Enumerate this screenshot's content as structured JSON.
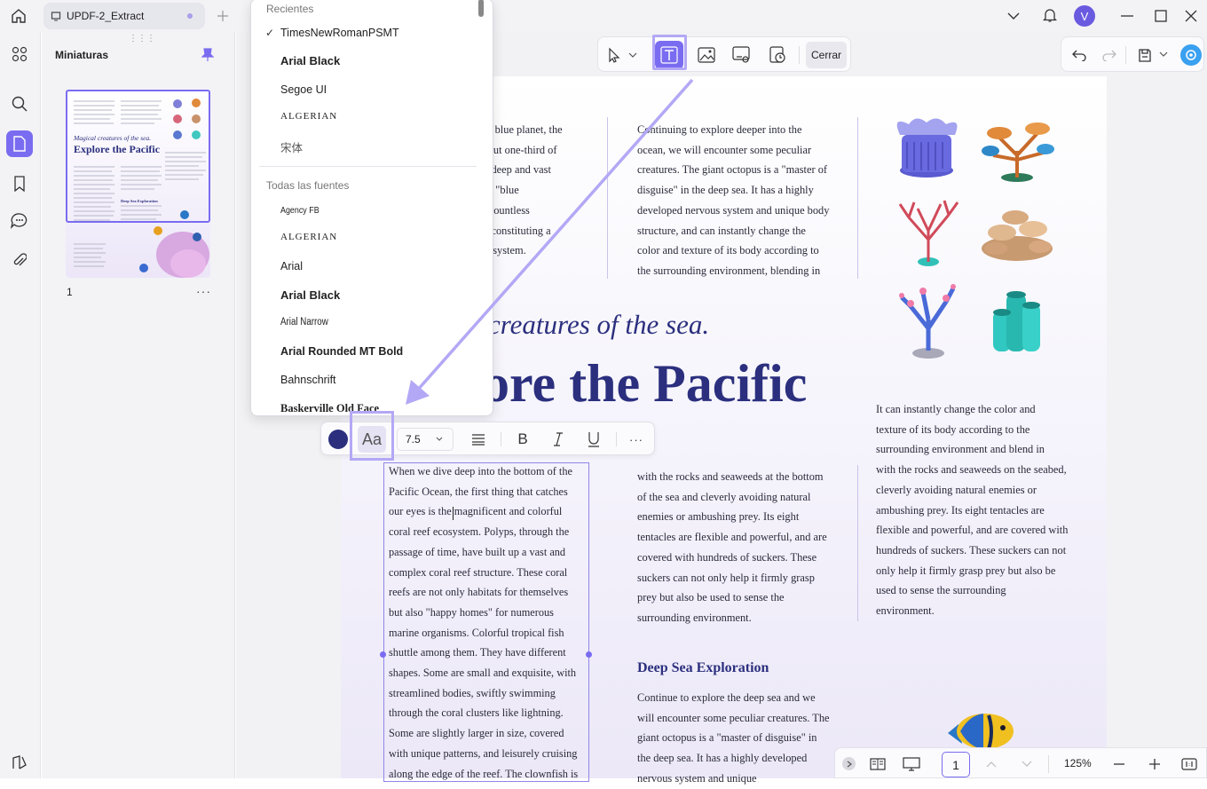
{
  "tab": {
    "title": "UPDF-2_Extract"
  },
  "user": {
    "initial": "V"
  },
  "panel": {
    "title": "Miniaturas",
    "page_number": "1",
    "more": "···"
  },
  "toolbar": {
    "close_label": "Cerrar"
  },
  "font_dropdown": {
    "recent_header": "Recientes",
    "recent": [
      "TimesNewRomanPSMT",
      "Arial Black",
      "Segoe UI",
      "ALGERIAN",
      "宋体"
    ],
    "selected": "TimesNewRomanPSMT",
    "check": "✓",
    "all_header": "Todas las fuentes",
    "all": [
      "Agency FB",
      "ALGERIAN",
      "Arial",
      "Arial Black",
      "Arial Narrow",
      "Arial Rounded MT Bold",
      "Bahnschrift",
      "Baskerville Old Face"
    ]
  },
  "format_bar": {
    "aa_label": "Aa",
    "font_size": "7.5",
    "text_color": "#2b2f7e",
    "more": "···"
  },
  "document": {
    "col1_top": [
      "our blue planet, the",
      "about one-third of",
      "Its deep and vast",
      "ous \"blue",
      "to countless",
      "nd constituting a",
      "ecosystem."
    ],
    "col2_top": [
      "Continuing to explore deeper into the",
      "ocean, we will encounter some peculiar",
      "creatures. The giant octopus is a \"master of",
      "disguise\" in the deep sea. It has a highly",
      "developed nervous system and unique body",
      "structure, and can instantly change the",
      "color and texture of its body according to",
      "the surrounding environment, blending in"
    ],
    "subtitle": "creatures of the sea.",
    "title": "ore the Pacific",
    "editing_text": [
      "When we dive deep into the bottom of the",
      "Pacific Ocean, the first thing that catches",
      "our eyes is the magnificent and colorful",
      "coral reef ecosystem. Polyps, through the",
      "passage of time, have built up a vast and",
      "complex coral reef structure. These coral",
      "reefs are not only habitats for themselves",
      "but also \"happy homes\" for numerous",
      "marine organisms. Colorful tropical fish",
      "shuttle among them. They have different",
      "shapes. Some are small and exquisite, with",
      "streamlined bodies, swiftly swimming",
      "through the coral clusters like lightning.",
      "Some are slightly larger in size, covered",
      "with unique patterns, and leisurely cruising",
      "along the edge of the reef. The clownfish is"
    ],
    "col2_mid": [
      "with the rocks and seaweeds at the bottom",
      "of the sea and cleverly avoiding natural",
      "enemies or ambushing prey. Its eight",
      "tentacles are flexible and powerful, and are",
      "covered with hundreds of suckers. These",
      "suckers can not only help it firmly grasp",
      "prey but also be used to sense the",
      "surrounding environment."
    ],
    "col3": [
      "It can instantly change the color and",
      "texture of its body according to the",
      "surrounding environment and blend in",
      "with the rocks and seaweeds on the seabed,",
      "cleverly avoiding natural enemies or",
      "ambushing prey. Its eight tentacles are",
      "flexible and powerful, and are covered with",
      "hundreds of suckers. These suckers can not",
      "only help it firmly grasp prey but also be",
      "used to sense the surrounding",
      "environment."
    ],
    "section_heading": "Deep Sea Exploration",
    "section_text": [
      "Continue to explore the deep sea and we",
      "will encounter some peculiar creatures. The",
      "giant octopus is a \"master of disguise\" in",
      "the deep sea. It has a highly developed",
      "nervous system and unique"
    ]
  },
  "bottom_bar": {
    "page": "1",
    "zoom": "125%"
  }
}
